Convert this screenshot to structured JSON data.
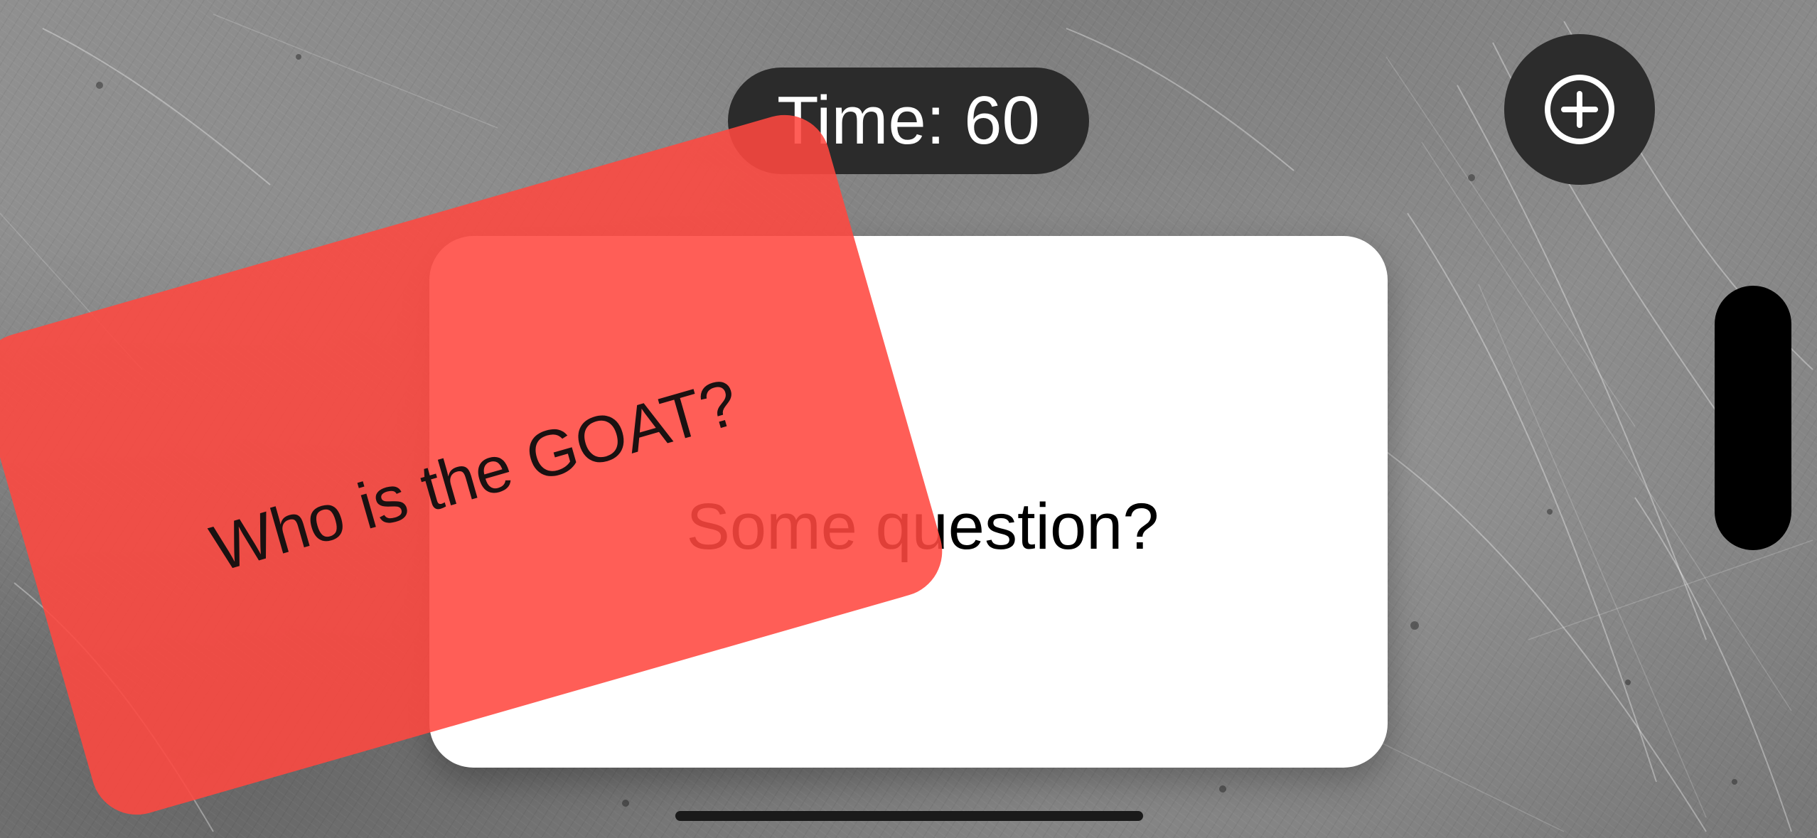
{
  "timer": {
    "label": "Time: 60"
  },
  "toolbar": {
    "add_icon": "plus-circle-icon"
  },
  "cards": {
    "back": {
      "question": "Some question?"
    },
    "front": {
      "question": "Who is the GOAT?",
      "color": "#FF4840"
    }
  },
  "colors": {
    "pill_background": "#2B2B2B",
    "card_background": "#FFFFFF",
    "side_pill": "#000000"
  }
}
